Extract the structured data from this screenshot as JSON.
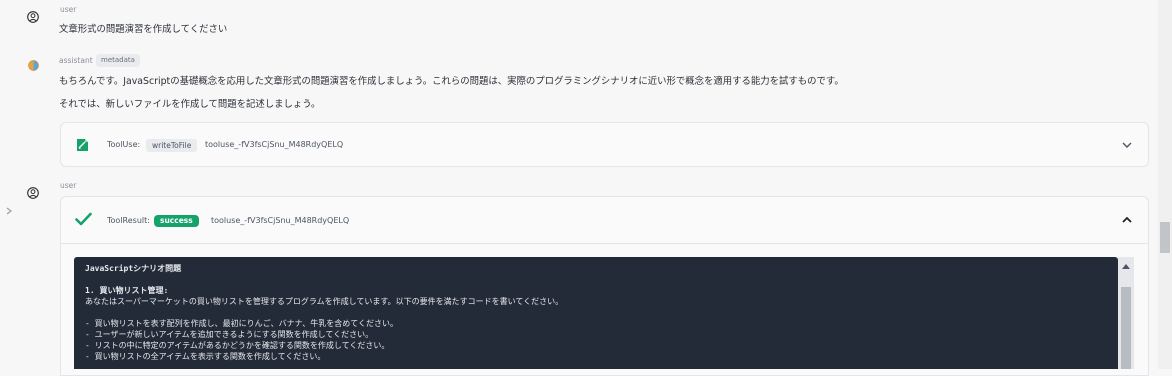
{
  "messages": [
    {
      "role": "user",
      "text": "文章形式の問題演習を作成してください"
    },
    {
      "role": "assistant",
      "badge": "metadata",
      "paragraphs": [
        "もちろんです。JavaScriptの基礎概念を応用した文章形式の問題演習を作成しましょう。これらの問題は、実際のプログラミングシナリオに近い形で概念を適用する能力を試すものです。",
        "それでは、新しいファイルを作成して問題を記述しましょう。"
      ],
      "tool_use": {
        "label": "ToolUse:",
        "tool_name": "writeToFile",
        "tool_id": "tooluse_-fV3fsCjSnu_M48RdyQELQ"
      }
    },
    {
      "role": "user",
      "tool_result": {
        "label": "ToolResult:",
        "status": "success",
        "tool_id": "tooluse_-fV3fsCjSnu_M48RdyQELQ",
        "content_lines": [
          "JavaScriptシナリオ問題",
          "",
          "1. 買い物リスト管理:",
          "あなたはスーパーマーケットの買い物リストを管理するプログラムを作成しています。以下の要件を満たすコードを書いてください。",
          "",
          "- 買い物リストを表す配列を作成し、最初にりんご、バナナ、牛乳を含めてください。",
          "- ユーザーが新しいアイテムを追加できるようにする関数を作成してください。",
          "- リストの中に特定のアイテムがあるかどうかを確認する関数を作成してください。",
          "- 買い物リストの全アイテムを表示する関数を作成してください。"
        ]
      }
    }
  ],
  "colors": {
    "success": "#16a36a",
    "code_bg": "#242b38",
    "tool_icon": "#16a36a"
  },
  "icons": {
    "user": "user-circle-icon",
    "assistant": "assistant-avatar-icon",
    "tool_use": "file-edit-icon",
    "tool_result": "checkmark-icon",
    "expand": "chevron-down-icon",
    "collapse": "chevron-up-icon",
    "sidebar": "chevron-right-icon"
  }
}
